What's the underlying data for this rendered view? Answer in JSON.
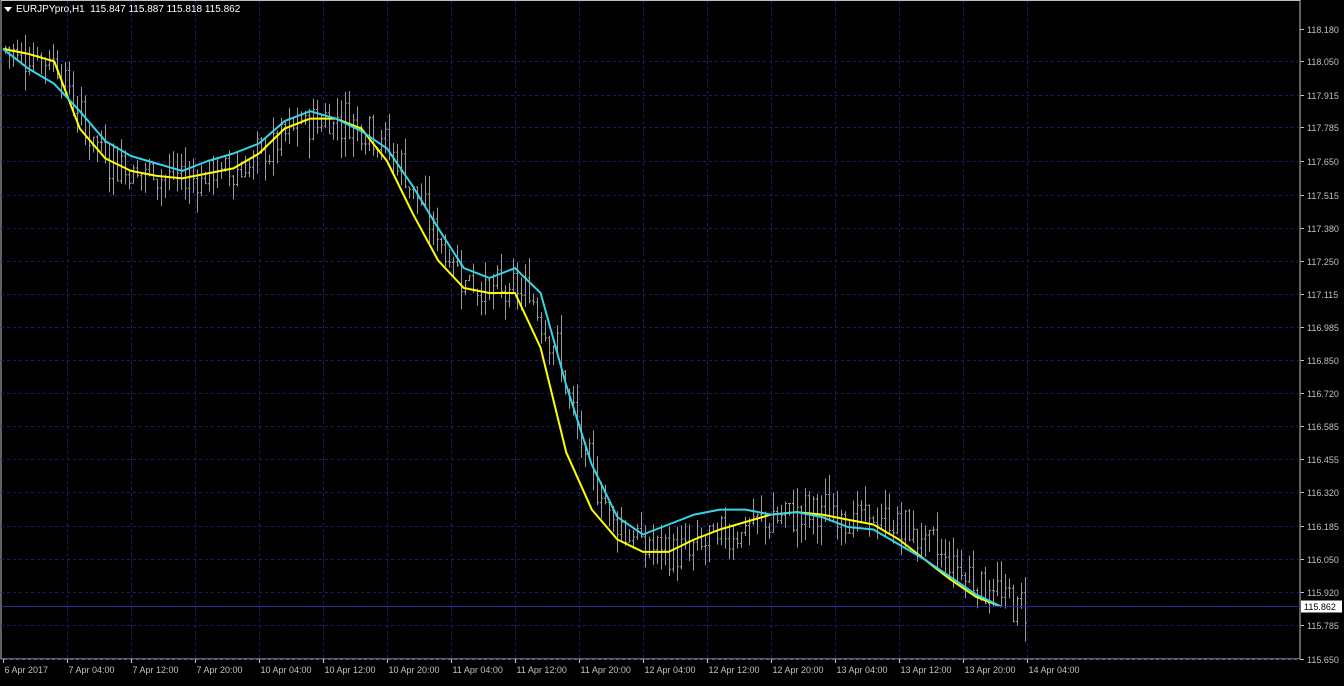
{
  "header": {
    "symbol": "EURJPYpro,H1",
    "ohlc": "115.847 115.887 115.818 115.862"
  },
  "price_label": "115.862",
  "colors": {
    "background": "#000000",
    "grid": "#1c1c6e",
    "axis": "#c0c0c0",
    "candles": "#9a9a9a",
    "ma_fast": "#ffff00",
    "ma_slow": "#33d6e6",
    "price_line": "#2a2a9a"
  },
  "chart_data": {
    "type": "line",
    "y_ticks": [
      "118.180",
      "118.050",
      "117.915",
      "117.785",
      "117.650",
      "117.515",
      "117.380",
      "117.250",
      "117.115",
      "116.985",
      "116.850",
      "116.720",
      "116.585",
      "116.455",
      "116.320",
      "116.185",
      "116.050",
      "115.920",
      "115.785",
      "115.650"
    ],
    "x_ticks": [
      "6 Apr 2017",
      "7 Apr 04:00",
      "7 Apr 12:00",
      "7 Apr 20:00",
      "10 Apr 04:00",
      "10 Apr 12:00",
      "10 Apr 20:00",
      "11 Apr 04:00",
      "11 Apr 12:00",
      "11 Apr 20:00",
      "12 Apr 04:00",
      "12 Apr 12:00",
      "12 Apr 20:00",
      "13 Apr 04:00",
      "13 Apr 12:00",
      "13 Apr 20:00",
      "14 Apr 04:00"
    ],
    "ylim": [
      115.65,
      118.18
    ],
    "bars_count": 256,
    "current_price": 115.862,
    "series": [
      {
        "name": "",
        "role": "fast",
        "points": [
          [
            0,
            118.1
          ],
          [
            16,
            118.08
          ],
          [
            32,
            118.05
          ],
          [
            48,
            117.78
          ],
          [
            64,
            117.66
          ],
          [
            80,
            117.61
          ],
          [
            96,
            117.59
          ],
          [
            112,
            117.58
          ],
          [
            128,
            117.6
          ],
          [
            144,
            117.62
          ],
          [
            160,
            117.68
          ],
          [
            176,
            117.78
          ],
          [
            192,
            117.82
          ],
          [
            208,
            117.82
          ],
          [
            224,
            117.78
          ],
          [
            240,
            117.65
          ],
          [
            256,
            117.44
          ],
          [
            272,
            117.25
          ],
          [
            288,
            117.14
          ],
          [
            304,
            117.12
          ],
          [
            320,
            117.12
          ],
          [
            336,
            116.9
          ],
          [
            352,
            116.48
          ],
          [
            368,
            116.25
          ],
          [
            384,
            116.13
          ],
          [
            400,
            116.08
          ],
          [
            416,
            116.08
          ],
          [
            432,
            116.13
          ],
          [
            448,
            116.17
          ],
          [
            464,
            116.2
          ],
          [
            480,
            116.23
          ],
          [
            496,
            116.24
          ],
          [
            512,
            116.23
          ],
          [
            528,
            116.21
          ],
          [
            544,
            116.19
          ],
          [
            560,
            116.13
          ],
          [
            576,
            116.05
          ],
          [
            592,
            115.97
          ],
          [
            608,
            115.9
          ],
          [
            624,
            115.86
          ]
        ]
      },
      {
        "name": "",
        "role": "slow",
        "points": [
          [
            0,
            118.1
          ],
          [
            16,
            118.02
          ],
          [
            32,
            117.96
          ],
          [
            48,
            117.85
          ],
          [
            64,
            117.73
          ],
          [
            80,
            117.67
          ],
          [
            96,
            117.64
          ],
          [
            112,
            117.61
          ],
          [
            128,
            117.65
          ],
          [
            144,
            117.68
          ],
          [
            160,
            117.72
          ],
          [
            176,
            117.81
          ],
          [
            192,
            117.85
          ],
          [
            208,
            117.82
          ],
          [
            224,
            117.77
          ],
          [
            240,
            117.7
          ],
          [
            256,
            117.55
          ],
          [
            272,
            117.38
          ],
          [
            288,
            117.22
          ],
          [
            304,
            117.18
          ],
          [
            320,
            117.22
          ],
          [
            336,
            117.12
          ],
          [
            352,
            116.75
          ],
          [
            368,
            116.43
          ],
          [
            384,
            116.22
          ],
          [
            400,
            116.15
          ],
          [
            416,
            116.19
          ],
          [
            432,
            116.23
          ],
          [
            448,
            116.25
          ],
          [
            464,
            116.25
          ],
          [
            480,
            116.23
          ],
          [
            496,
            116.24
          ],
          [
            512,
            116.22
          ],
          [
            528,
            116.18
          ],
          [
            544,
            116.17
          ],
          [
            560,
            116.11
          ],
          [
            576,
            116.05
          ],
          [
            592,
            115.98
          ],
          [
            608,
            115.91
          ],
          [
            624,
            115.86
          ]
        ]
      }
    ]
  }
}
